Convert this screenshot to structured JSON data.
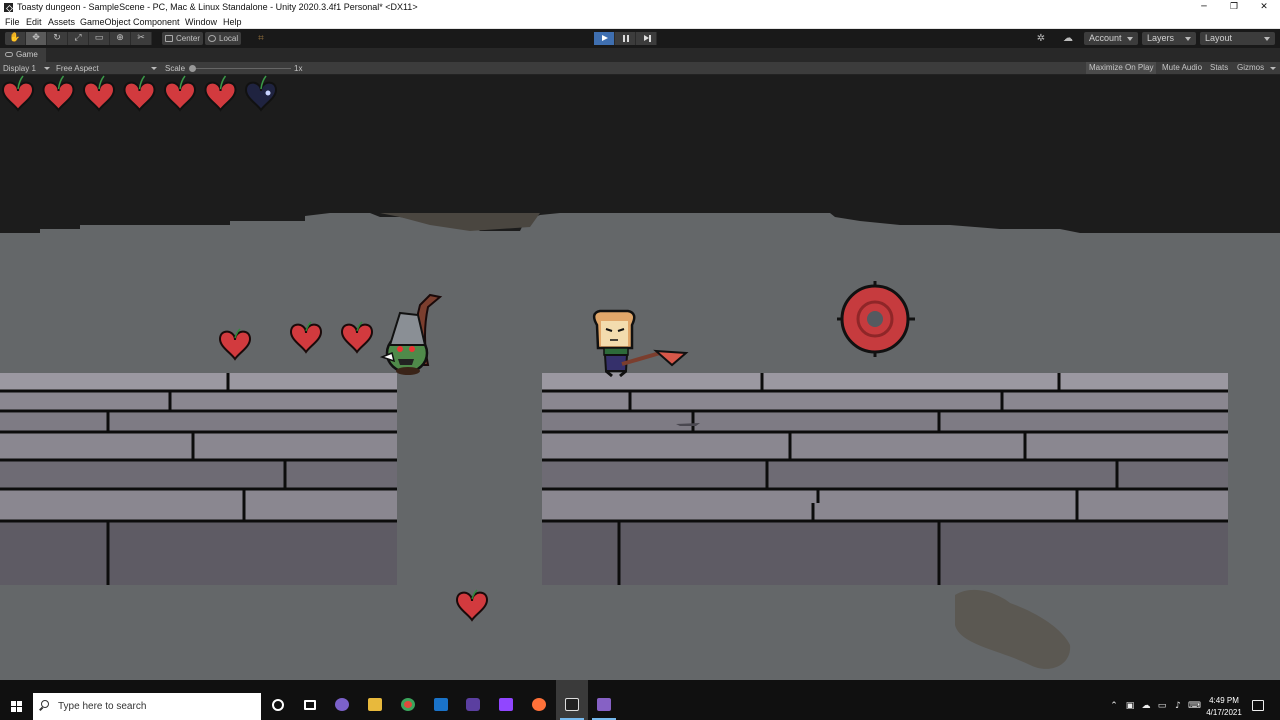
{
  "window": {
    "title": "Toasty dungeon - SampleScene - PC, Mac & Linux Standalone - Unity 2020.3.4f1 Personal* <DX11>",
    "minimize": "─",
    "restore": "❐",
    "close": "✕"
  },
  "menu": [
    "File",
    "Edit",
    "Assets",
    "GameObject",
    "Component",
    "Window",
    "Help"
  ],
  "toolbar": {
    "pivot_label": "Center",
    "space_label": "Local",
    "account_label": "Account",
    "layers_label": "Layers",
    "layout_label": "Layout"
  },
  "game_view": {
    "tab_label": "Game",
    "display_label": "Display 1",
    "aspect_label": "Free Aspect",
    "scale_label": "Scale",
    "scale_value": "1x",
    "maximize_label": "Maximize On Play",
    "mute_label": "Mute Audio",
    "stats_label": "Stats",
    "gizmos_label": "Gizmos"
  },
  "game": {
    "health_full": 6,
    "health_max": 7,
    "colors": {
      "heart": "#d23a3e",
      "heart_empty": "#1f2340",
      "floor": "#646769",
      "ceiling": "#1c1c1c",
      "brick": "#8a8790"
    }
  },
  "taskbar": {
    "search_placeholder": "Type here to search",
    "time": "4:49 PM",
    "date": "4/17/2021"
  }
}
